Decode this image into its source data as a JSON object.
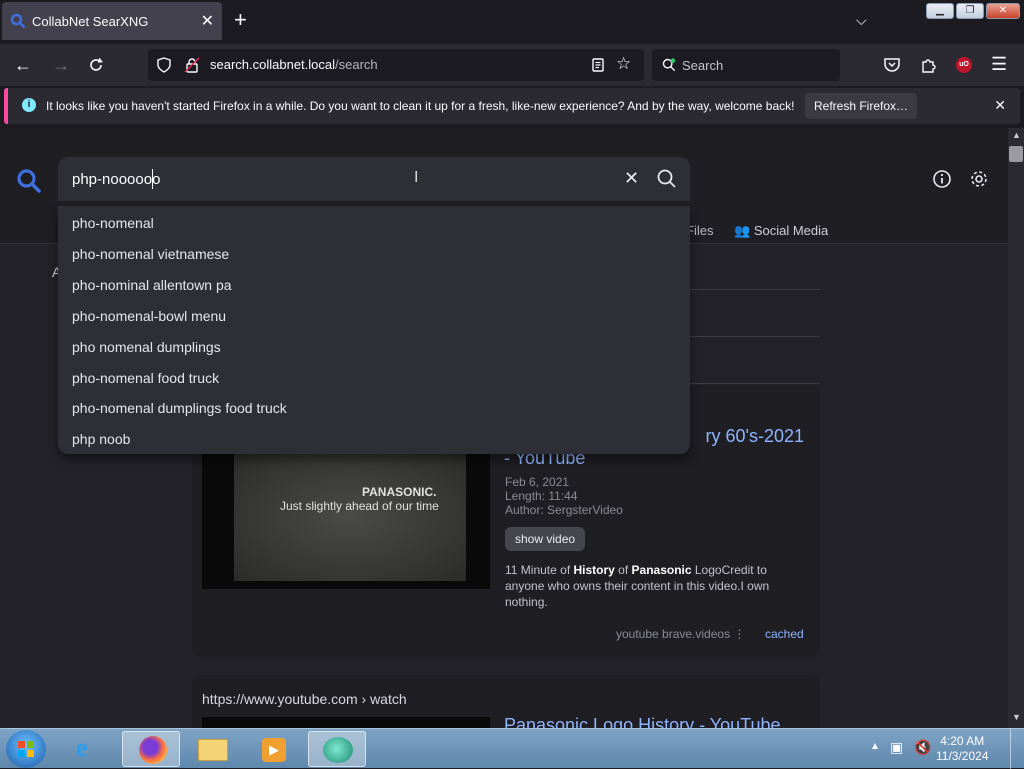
{
  "browser": {
    "tab_title": "CollabNet SearXNG",
    "tab_close": "✕",
    "new_tab": "+",
    "url_host": "search.collabnet.local",
    "url_path": "/search",
    "search_placeholder": "Search"
  },
  "notification": {
    "message": "It looks like you haven't started Firefox in a while. Do you want to clean it up for a fresh, like-new experience? And by the way, welcome back!",
    "button": "Refresh Firefox…",
    "close": "✕"
  },
  "search": {
    "query": "php-noooooo",
    "suggestions": [
      "pho-nomenal",
      "pho-nomenal vietnamese",
      "pho-nominal allentown pa",
      "pho-nomenal-bowl menu",
      "pho nomenal dumplings",
      "pho-nomenal food truck",
      "pho-nomenal dumplings food truck",
      "php noob"
    ]
  },
  "categories": {
    "files": "Files",
    "social": "Social Media",
    "left_letter": "A"
  },
  "result1": {
    "title_part1": "ry 60's-2021",
    "title_part2": "- YouTube",
    "date": "Feb 6, 2021",
    "length": "Length: 11:44",
    "author": "Author: SergsterVideo",
    "show_video": "show video",
    "thumb_brand": "PANASONIC.",
    "thumb_slogan": "Just slightly ahead of our time",
    "desc_1": "11 Minute of ",
    "desc_b1": "History",
    "desc_2": " of ",
    "desc_b2": "Panasonic",
    "desc_3": " LogoCredit to anyone who owns their content in this video.I own nothing.",
    "engines": "youtube  brave.videos",
    "cached": "cached"
  },
  "result2": {
    "url": "https://www.youtube.com  › watch",
    "title": "Panasonic Logo History - YouTube"
  },
  "taskbar": {
    "time": "4:20 AM",
    "date": "11/3/2024"
  },
  "colors": {
    "accent": "#8fb4ff",
    "notif_stripe": "#ff4aa2",
    "logo_blue": "#3d6fe0"
  }
}
